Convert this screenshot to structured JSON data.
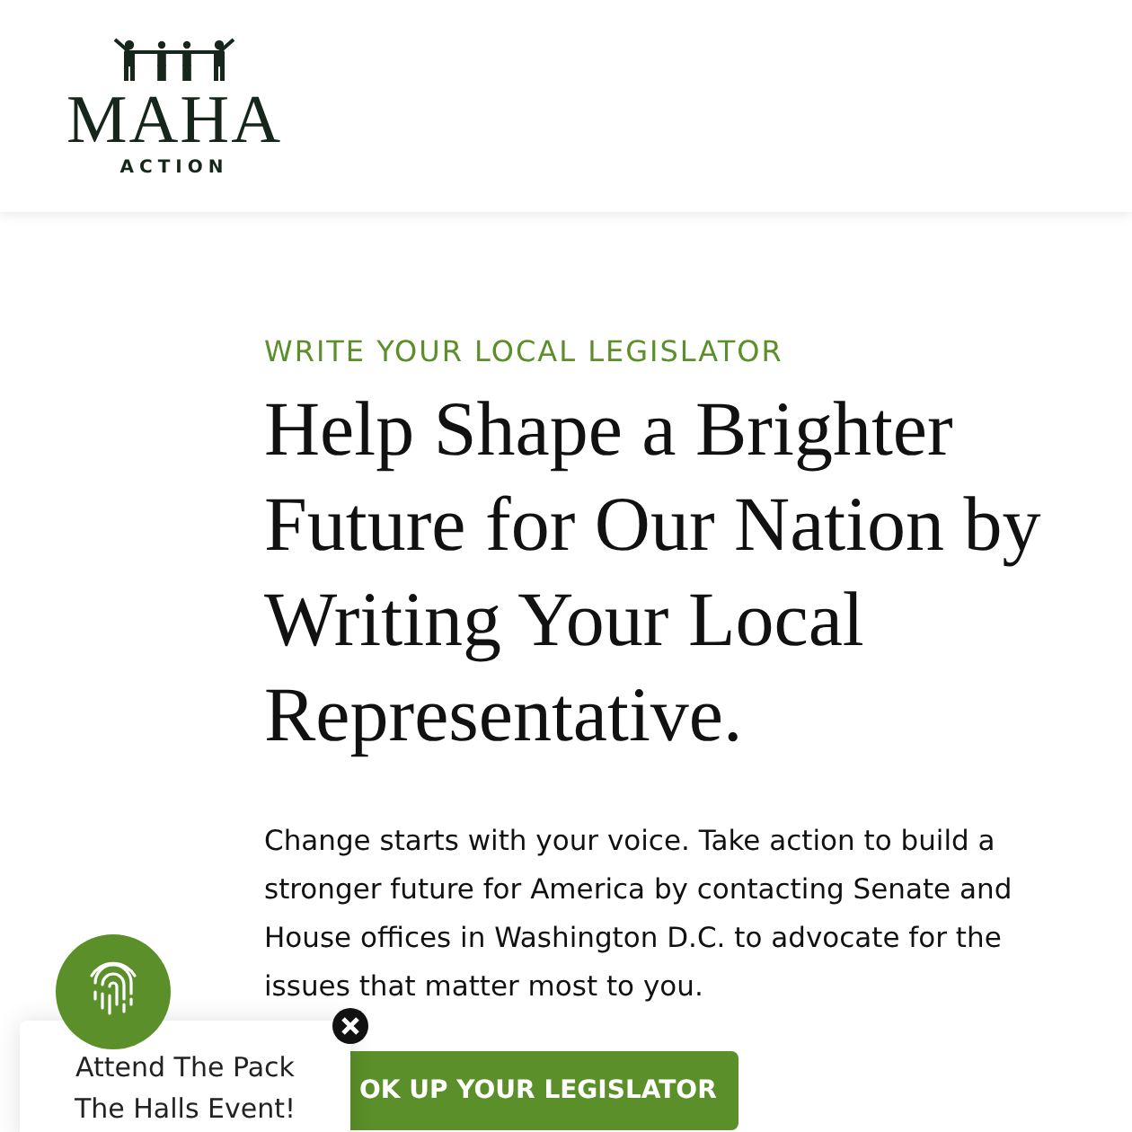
{
  "header": {
    "logo": {
      "name": "MAHA",
      "tagline": "ACTION"
    }
  },
  "hero": {
    "eyebrow": "WRITE YOUR LOCAL LEGISLATOR",
    "heading": "Help Shape a Brighter Future for Our Nation by Writing Your Local Representative.",
    "body": "Change starts with your voice. Take action to build a stronger future for America by contacting Senate and House offices in Washington D.C. to advocate for the issues that matter most to you.",
    "button": "OK UP YOUR LEGISLATOR"
  },
  "popup": {
    "text": "Attend The Pack The Halls Event!"
  }
}
